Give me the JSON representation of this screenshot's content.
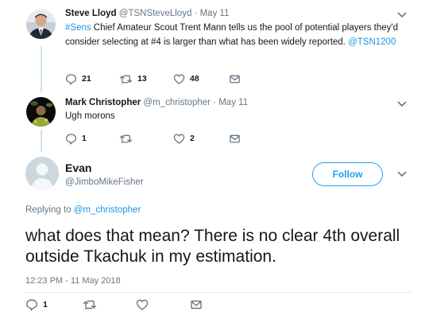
{
  "tweet1": {
    "name": "Steve Lloyd",
    "handle": "@TSNSteveLloyd",
    "separator": "·",
    "date": "May 11",
    "text_link1": "#Sens",
    "text_part1": " Chief Amateur Scout Trent Mann tells us the pool of potential players they'd consider selecting at #4 is larger than what has been widely reported. ",
    "text_link2": "@TSN1200",
    "replies": "21",
    "retweets": "13",
    "likes": "48"
  },
  "tweet2": {
    "name": "Mark Christopher",
    "handle": "@m_christopher",
    "separator": "·",
    "date": "May 11",
    "text": "Ugh morons",
    "replies": "1",
    "retweets": "",
    "likes": "2"
  },
  "main": {
    "name": "Evan",
    "handle": "@JimboMikeFisher",
    "follow_label": "Follow",
    "replying_prefix": "Replying to ",
    "replying_to": "@m_christopher",
    "text": "what does that mean? There is no clear 4th overall outside Tkachuk in my estimation.",
    "timestamp": "12:23 PM - 11 May 2018",
    "replies": "1",
    "retweets": "",
    "likes": ""
  },
  "colors": {
    "accent": "#1da1f2",
    "link": "#1b95e0",
    "muted": "#657786",
    "thread_line": "#cce3f4"
  },
  "icons": [
    "reply-icon",
    "retweet-icon",
    "like-icon",
    "message-icon",
    "chevron-down-icon"
  ]
}
